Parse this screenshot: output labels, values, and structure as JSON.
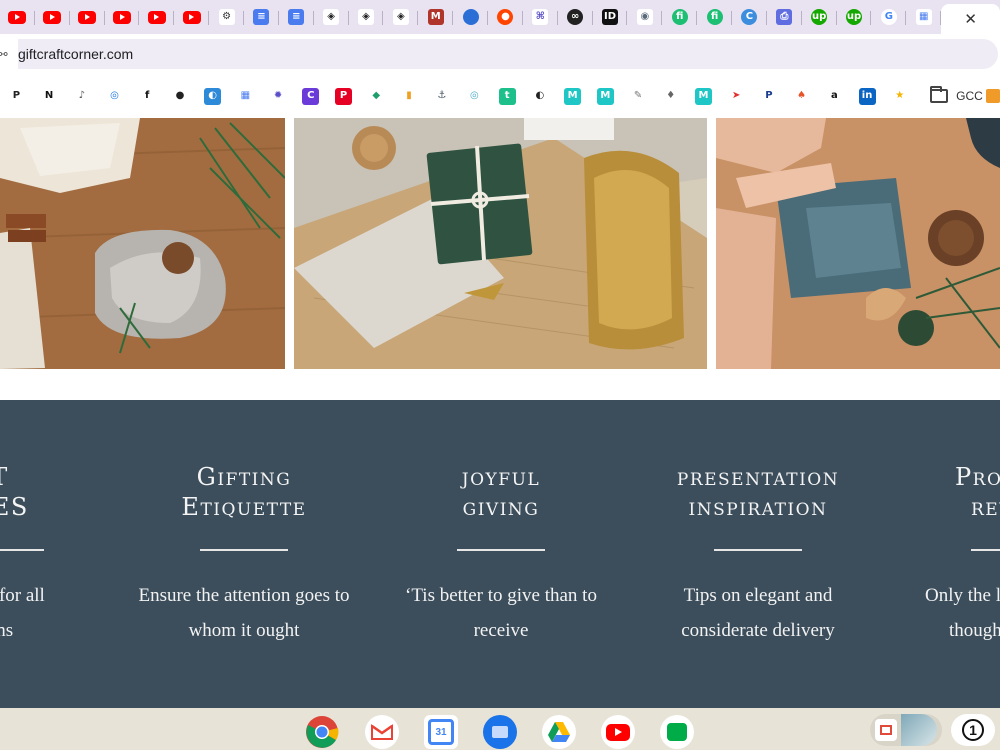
{
  "browser": {
    "tabs": [
      {
        "icon": "youtube-icon",
        "kind": "yt"
      },
      {
        "icon": "youtube-icon",
        "kind": "yt"
      },
      {
        "icon": "youtube-icon",
        "kind": "yt"
      },
      {
        "icon": "youtube-icon",
        "kind": "yt"
      },
      {
        "icon": "youtube-icon",
        "kind": "yt"
      },
      {
        "icon": "youtube-icon",
        "kind": "yt"
      },
      {
        "icon": "openai-icon",
        "kind": "glyph",
        "glyph": "⚙",
        "bg": "#ffffff",
        "fg": "#333333"
      },
      {
        "icon": "google-docs-icon",
        "kind": "glyph",
        "glyph": "≡",
        "bg": "#4a7cf0",
        "fg": "#ffffff"
      },
      {
        "icon": "google-docs-icon",
        "kind": "glyph",
        "glyph": "≡",
        "bg": "#4a7cf0",
        "fg": "#ffffff"
      },
      {
        "icon": "diamond-icon",
        "kind": "glyph",
        "glyph": "◈",
        "bg": "#ffffff",
        "fg": "#222222"
      },
      {
        "icon": "diamond-icon",
        "kind": "glyph",
        "glyph": "◈",
        "bg": "#ffffff",
        "fg": "#222222"
      },
      {
        "icon": "diamond-icon",
        "kind": "glyph",
        "glyph": "◈",
        "bg": "#ffffff",
        "fg": "#222222"
      },
      {
        "icon": "m-logo-icon",
        "kind": "glyph",
        "glyph": "M",
        "bg": "#b0352a",
        "fg": "#ffffff"
      },
      {
        "icon": "blue-dot-icon",
        "kind": "round",
        "glyph": "",
        "bg": "#2b6fd6",
        "fg": "#ffffff"
      },
      {
        "icon": "reddit-icon",
        "kind": "round",
        "glyph": "●",
        "bg": "#ff4500",
        "fg": "#ffffff"
      },
      {
        "icon": "grid-logo-icon",
        "kind": "glyph",
        "glyph": "⌘",
        "bg": "#ffffff",
        "fg": "#5a4fc9"
      },
      {
        "icon": "copilot-icon",
        "kind": "round",
        "glyph": "∞",
        "bg": "#222222",
        "fg": "#ffffff"
      },
      {
        "icon": "id-logo-icon",
        "kind": "glyph",
        "glyph": "ID",
        "bg": "#111111",
        "fg": "#ffffff"
      },
      {
        "icon": "eye-icon",
        "kind": "glyph",
        "glyph": "◉",
        "bg": "#ffffff",
        "fg": "#5a6a7a"
      },
      {
        "icon": "fiverr-icon",
        "kind": "round",
        "glyph": "fi",
        "bg": "#1dbf73",
        "fg": "#ffffff"
      },
      {
        "icon": "fiverr-icon",
        "kind": "round",
        "glyph": "fi",
        "bg": "#1dbf73",
        "fg": "#ffffff"
      },
      {
        "icon": "c-logo-icon",
        "kind": "round",
        "glyph": "C",
        "bg": "#3c8dde",
        "fg": "#ffffff"
      },
      {
        "icon": "printer-icon",
        "kind": "glyph",
        "glyph": "⎙",
        "bg": "#5f6de0",
        "fg": "#ffffff"
      },
      {
        "icon": "upwork-icon",
        "kind": "round",
        "glyph": "up",
        "bg": "#14a800",
        "fg": "#ffffff"
      },
      {
        "icon": "upwork-icon",
        "kind": "round",
        "glyph": "up",
        "bg": "#14a800",
        "fg": "#ffffff"
      },
      {
        "icon": "google-icon",
        "kind": "round",
        "glyph": "G",
        "bg": "#ffffff",
        "fg": "#4285f4"
      },
      {
        "icon": "apps-grid-icon",
        "kind": "glyph",
        "glyph": "▦",
        "bg": "#ffffff",
        "fg": "#4a7cf0"
      }
    ],
    "active_tab_close": "✕",
    "address": {
      "url": "giftcraftcorner.com"
    },
    "bookmarks": [
      {
        "icon": "p-logo-icon",
        "glyph": "P",
        "bg": "#ffffff",
        "fg": "#222222"
      },
      {
        "icon": "notion-icon",
        "glyph": "N",
        "bg": "#ffffff",
        "fg": "#111111"
      },
      {
        "icon": "bell-icon",
        "glyph": "♪",
        "bg": "#ffffff",
        "fg": "#555555"
      },
      {
        "icon": "circle-c-icon",
        "glyph": "◎",
        "bg": "#ffffff",
        "fg": "#1a73e8"
      },
      {
        "icon": "facebook-icon",
        "glyph": "f",
        "bg": "#ffffff",
        "fg": "#111111"
      },
      {
        "icon": "bomb-icon",
        "glyph": "●",
        "bg": "#ffffff",
        "fg": "#222222"
      },
      {
        "icon": "swirl-icon",
        "glyph": "◐",
        "bg": "#2d8ad8",
        "fg": "#ffffff"
      },
      {
        "icon": "apps-grid-icon",
        "glyph": "▦",
        "bg": "#ffffff",
        "fg": "#4a7cf0"
      },
      {
        "icon": "gear-flower-icon",
        "glyph": "✹",
        "bg": "#ffffff",
        "fg": "#5a4fc9"
      },
      {
        "icon": "canva-icon",
        "glyph": "C",
        "bg": "#6a3bd8",
        "fg": "#ffffff"
      },
      {
        "icon": "pinterest-icon",
        "glyph": "P",
        "bg": "#e60023",
        "fg": "#ffffff"
      },
      {
        "icon": "chat-bubbles-icon",
        "glyph": "◆",
        "bg": "#ffffff",
        "fg": "#1e9e6a"
      },
      {
        "icon": "bar-chart-icon",
        "glyph": "▮",
        "bg": "#ffffff",
        "fg": "#f0a020"
      },
      {
        "icon": "ship-icon",
        "glyph": "⚓",
        "bg": "#ffffff",
        "fg": "#4a5a6a"
      },
      {
        "icon": "spiral-icon",
        "glyph": "◎",
        "bg": "#ffffff",
        "fg": "#4aa9c9"
      },
      {
        "icon": "t-logo-icon",
        "glyph": "t",
        "bg": "#1dbf8a",
        "fg": "#ffffff"
      },
      {
        "icon": "globe-icon",
        "glyph": "◐",
        "bg": "#ffffff",
        "fg": "#222222"
      },
      {
        "icon": "bookmark-m-icon",
        "glyph": "M",
        "bg": "#1ec6c6",
        "fg": "#ffffff"
      },
      {
        "icon": "bookmark-m-icon",
        "glyph": "M",
        "bg": "#1ec6c6",
        "fg": "#ffffff"
      },
      {
        "icon": "sketch-icon",
        "glyph": "✎",
        "bg": "#ffffff",
        "fg": "#777777"
      },
      {
        "icon": "microphone-icon",
        "glyph": "♦",
        "bg": "#ffffff",
        "fg": "#666666"
      },
      {
        "icon": "bookmark-m-icon",
        "glyph": "M",
        "bg": "#1ec6c6",
        "fg": "#ffffff"
      },
      {
        "icon": "red-swoosh-icon",
        "glyph": "➤",
        "bg": "#ffffff",
        "fg": "#e23030"
      },
      {
        "icon": "paypal-icon",
        "glyph": "P",
        "bg": "#ffffff",
        "fg": "#1a3d8f"
      },
      {
        "icon": "flame-icon",
        "glyph": "♠",
        "bg": "#ffffff",
        "fg": "#e8542a"
      },
      {
        "icon": "amazon-icon",
        "glyph": "a",
        "bg": "#ffffff",
        "fg": "#111111"
      },
      {
        "icon": "linkedin-icon",
        "glyph": "in",
        "bg": "#0a66c2",
        "fg": "#ffffff"
      },
      {
        "icon": "star-icon",
        "glyph": "★",
        "bg": "#ffffff",
        "fg": "#f4b400"
      }
    ],
    "bookmark_folder": {
      "label": "GCC"
    }
  },
  "page": {
    "features": [
      {
        "title_line1": "Gift",
        "title_line2": "Guides",
        "title_display1": "T",
        "title_display2": "DES",
        "desc_line1": "ideas for all",
        "desc_line2": "ons"
      },
      {
        "title_line1": "Gifting",
        "title_line2": "Etiquette",
        "desc_line1": "Ensure the attention goes to",
        "desc_line2": "whom it ought"
      },
      {
        "title_line1": "joyful",
        "title_line2": "giving",
        "desc_line1": "‘Tis better to give than to",
        "desc_line2": "receive"
      },
      {
        "title_line1": "presentation",
        "title_line2": "inspiration",
        "desc_line1": "Tips on elegant and",
        "desc_line2": "considerate delivery"
      },
      {
        "title_line1": "Pro",
        "title_line2": "rev",
        "desc_line1": "Only the l",
        "desc_line2": "though"
      }
    ]
  },
  "shelf": {
    "apps": [
      {
        "name": "chrome-icon"
      },
      {
        "name": "gmail-icon"
      },
      {
        "name": "calendar-icon",
        "label": "31"
      },
      {
        "name": "files-icon"
      },
      {
        "name": "drive-icon"
      },
      {
        "name": "youtube-icon"
      },
      {
        "name": "meet-icon"
      }
    ],
    "notification_count": "1"
  }
}
